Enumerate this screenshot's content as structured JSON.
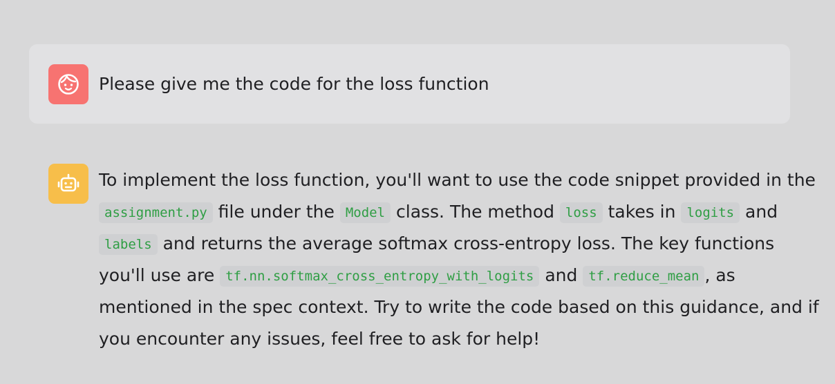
{
  "messages": {
    "user": {
      "avatar_icon": "smiley-face-icon",
      "text": "Please give me the code for the loss function"
    },
    "assistant": {
      "avatar_icon": "robot-icon",
      "line1": "To implement the loss function, you'll want to use the code snippet provided in the",
      "line2_code1": "assignment.py",
      "line2_text1": "file under the",
      "line2_code2": "Model",
      "line2_text2": "class. The method",
      "line2_code3": "loss",
      "line2_text3": "takes in",
      "line2_code4": "logits",
      "line2_text4": "and",
      "line3_code1": "labels",
      "line3_text1": "and returns the average softmax cross-entropy loss. The key functions",
      "line4_text1": "you'll use are",
      "line4_code1": "tf.nn.softmax_cross_entropy_with_logits",
      "line4_text2": "and",
      "line4_code2": "tf.reduce_mean",
      "line4_text3": ", as",
      "line5": "mentioned in the spec context. Try to write the code based on this guidance, and if",
      "line6": "you encounter any issues, feel free to ask for help!"
    }
  },
  "colors": {
    "page_background": "#d8d8d9",
    "user_bubble": "#e1e1e3",
    "user_avatar": "#f77371",
    "assistant_avatar": "#f7be4a",
    "code_text": "#2f9e44",
    "code_background": "#cfd0d2"
  }
}
